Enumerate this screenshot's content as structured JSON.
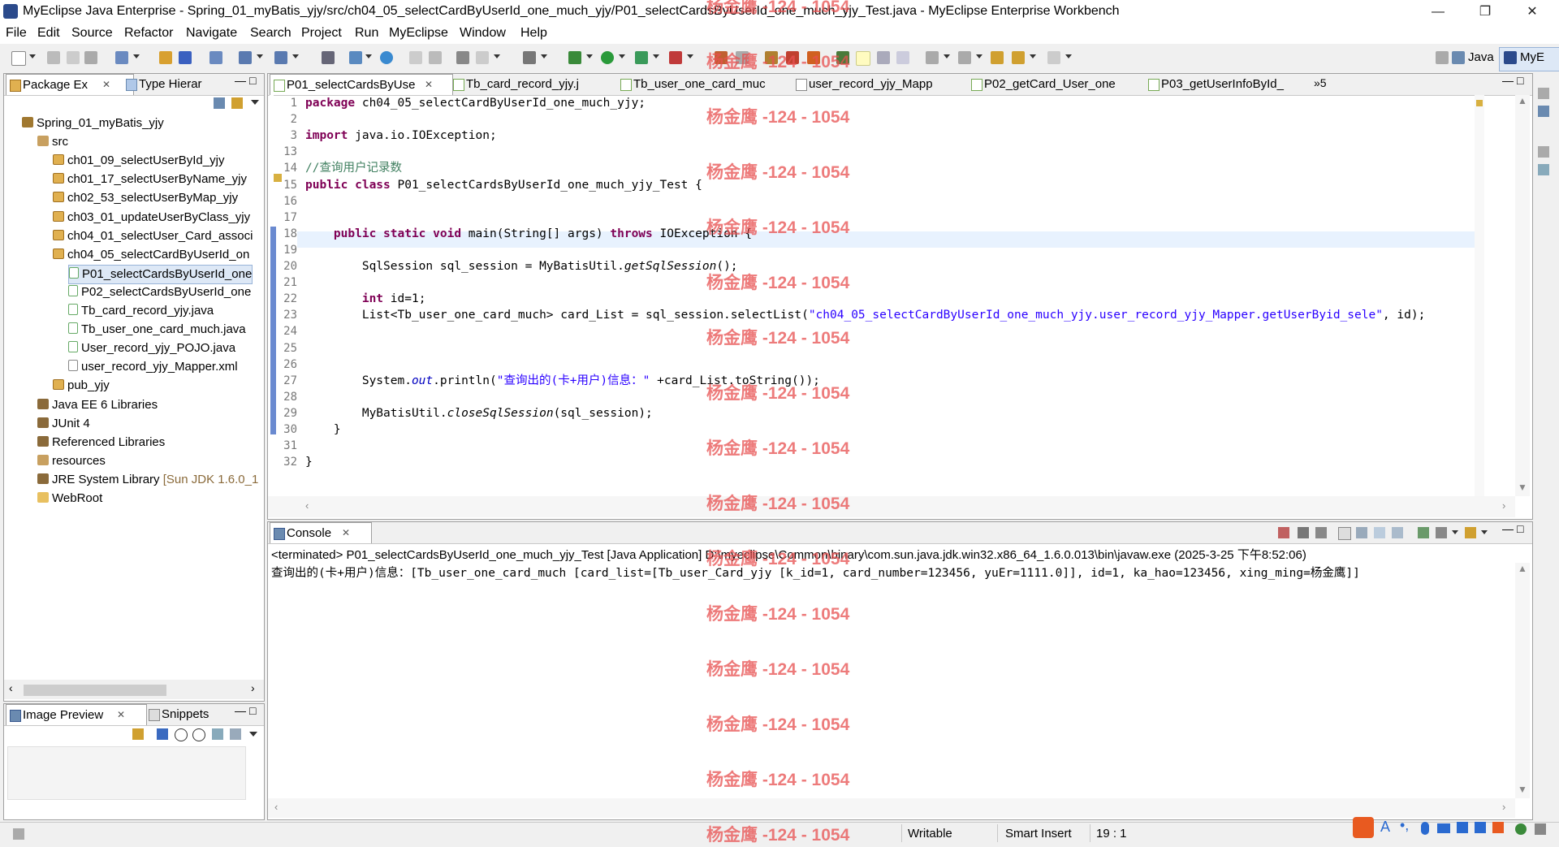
{
  "window": {
    "title": "MyEclipse Java Enterprise - Spring_01_myBatis_yjy/src/ch04_05_selectCardByUserId_one_much_yjy/P01_selectCardsByUserId_one_much_yjy_Test.java - MyEclipse Enterprise Workbench",
    "minimize": "—",
    "restore": "❐",
    "close": "✕"
  },
  "menu": [
    "File",
    "Edit",
    "Source",
    "Refactor",
    "Navigate",
    "Search",
    "Project",
    "Run",
    "MyEclipse",
    "Window",
    "Help"
  ],
  "perspectives": {
    "java": "Java",
    "myeclipse": "MyE"
  },
  "package_explorer": {
    "tabs": [
      "Package Ex",
      "Type Hierar"
    ],
    "tree": [
      {
        "label": "Spring_01_myBatis_yjy",
        "icon": "project-icon",
        "depth": 0
      },
      {
        "label": "src",
        "icon": "source-folder-icon",
        "depth": 1
      },
      {
        "label": "ch01_09_selectUserById_yjy",
        "icon": "package-icon",
        "depth": 2
      },
      {
        "label": "ch01_17_selectUserByName_yjy",
        "icon": "package-icon",
        "depth": 2
      },
      {
        "label": "ch02_53_selectUserByMap_yjy",
        "icon": "package-icon",
        "depth": 2
      },
      {
        "label": "ch03_01_updateUserByClass_yjy",
        "icon": "package-icon",
        "depth": 2
      },
      {
        "label": "ch04_01_selectUser_Card_associ",
        "icon": "package-icon",
        "depth": 2
      },
      {
        "label": "ch04_05_selectCardByUserId_on",
        "icon": "package-icon",
        "depth": 2
      },
      {
        "label": "P01_selectCardsByUserId_one",
        "icon": "java-file-icon",
        "depth": 3,
        "selected": true
      },
      {
        "label": "P02_selectCardsByUserId_one",
        "icon": "java-file-icon",
        "depth": 3
      },
      {
        "label": "Tb_card_record_yjy.java",
        "icon": "java-file-icon",
        "depth": 3
      },
      {
        "label": "Tb_user_one_card_much.java",
        "icon": "java-file-icon",
        "depth": 3
      },
      {
        "label": "User_record_yjy_POJO.java",
        "icon": "java-file-icon",
        "depth": 3
      },
      {
        "label": "user_record_yjy_Mapper.xml",
        "icon": "xml-file-icon",
        "depth": 3
      },
      {
        "label": "pub_yjy",
        "icon": "package-icon",
        "depth": 2
      },
      {
        "label": "Java EE 6 Libraries",
        "icon": "library-icon",
        "depth": 1
      },
      {
        "label": "JUnit 4",
        "icon": "library-icon",
        "depth": 1
      },
      {
        "label": "Referenced Libraries",
        "icon": "library-icon",
        "depth": 1
      },
      {
        "label": "resources",
        "icon": "source-folder-icon",
        "depth": 1
      },
      {
        "label": "JRE System Library",
        "suffix": "[Sun JDK 1.6.0_1",
        "icon": "library-icon",
        "depth": 1
      },
      {
        "label": "WebRoot",
        "icon": "folder-icon",
        "depth": 1
      }
    ]
  },
  "bottom_left": {
    "tabs": [
      "Image Preview",
      "Snippets"
    ]
  },
  "editor": {
    "tabs": [
      "P01_selectCardsByUse",
      "Tb_card_record_yjy.j",
      "Tb_user_one_card_muc",
      "user_record_yjy_Mapp",
      "P02_getCard_User_one",
      "P03_getUserInfoById_"
    ],
    "overflow": "»5",
    "lines": [
      {
        "n": "1",
        "segs": [
          {
            "c": "kw",
            "t": "package"
          },
          {
            "c": "",
            "t": " ch04_05_selectCardByUserId_one_much_yjy;"
          }
        ]
      },
      {
        "n": "2",
        "segs": []
      },
      {
        "n": "3",
        "segs": [
          {
            "c": "kw",
            "t": "import"
          },
          {
            "c": "",
            "t": " java.io.IOException;"
          }
        ]
      },
      {
        "n": "13",
        "segs": []
      },
      {
        "n": "14",
        "segs": [
          {
            "c": "cm",
            "t": "//查询用户记录数"
          }
        ]
      },
      {
        "n": "15",
        "segs": [
          {
            "c": "kw",
            "t": "public class"
          },
          {
            "c": "",
            "t": " P01_selectCardsByUserId_one_much_yjy_Test {"
          }
        ]
      },
      {
        "n": "16",
        "segs": []
      },
      {
        "n": "17",
        "segs": []
      },
      {
        "n": "18",
        "segs": [
          {
            "c": "",
            "t": "    "
          },
          {
            "c": "kw",
            "t": "public static void"
          },
          {
            "c": "",
            "t": " main(String[] args) "
          },
          {
            "c": "kw",
            "t": "throws"
          },
          {
            "c": "",
            "t": " IOException {"
          }
        ]
      },
      {
        "n": "19",
        "segs": []
      },
      {
        "n": "20",
        "segs": [
          {
            "c": "",
            "t": "        SqlSession sql_session = MyBatisUtil."
          },
          {
            "c": "it",
            "t": "getSqlSession"
          },
          {
            "c": "",
            "t": "();"
          }
        ]
      },
      {
        "n": "21",
        "segs": []
      },
      {
        "n": "22",
        "segs": [
          {
            "c": "",
            "t": "        "
          },
          {
            "c": "kw",
            "t": "int"
          },
          {
            "c": "",
            "t": " id=1;"
          }
        ]
      },
      {
        "n": "23",
        "segs": [
          {
            "c": "",
            "t": "        List<Tb_user_one_card_much> card_List = sql_session.selectList("
          },
          {
            "c": "st",
            "t": "\"ch04_05_selectCardByUserId_one_much_yjy.user_record_yjy_Mapper.getUserByid_sele\""
          },
          {
            "c": "",
            "t": ", id);"
          }
        ]
      },
      {
        "n": "24",
        "segs": []
      },
      {
        "n": "25",
        "segs": []
      },
      {
        "n": "26",
        "segs": []
      },
      {
        "n": "27",
        "segs": [
          {
            "c": "",
            "t": "        System."
          },
          {
            "c": "fld",
            "t": "out"
          },
          {
            "c": "",
            "t": ".println("
          },
          {
            "c": "st",
            "t": "\"查询出的(卡+用户)信息：\""
          },
          {
            "c": "",
            "t": " +card_List.toString());"
          }
        ]
      },
      {
        "n": "28",
        "segs": []
      },
      {
        "n": "29",
        "segs": [
          {
            "c": "",
            "t": "        MyBatisUtil."
          },
          {
            "c": "it",
            "t": "closeSqlSession"
          },
          {
            "c": "",
            "t": "(sql_session);"
          }
        ]
      },
      {
        "n": "30",
        "segs": [
          {
            "c": "",
            "t": "    }"
          }
        ]
      },
      {
        "n": "31",
        "segs": []
      },
      {
        "n": "32",
        "segs": [
          {
            "c": "",
            "t": "}"
          }
        ]
      }
    ]
  },
  "console": {
    "tab": "Console",
    "header": "<terminated> P01_selectCardsByUserId_one_much_yjy_Test [Java Application] D:\\myeclipse\\Common\\binary\\com.sun.java.jdk.win32.x86_64_1.6.0.013\\bin\\javaw.exe (2025-3-25 下午8:52:06)",
    "output": "查询出的(卡+用户)信息：[Tb_user_one_card_much [card_list=[Tb_user_Card_yjy [k_id=1, card_number=123456, yuEr=1111.0]], id=1, ka_hao=123456, xing_ming=杨金鹰]]"
  },
  "watermark": "杨金鹰 -124 - 1054",
  "status": {
    "mode": "Writable",
    "insert": "Smart Insert",
    "position": "19 : 1"
  },
  "colors": {
    "keyword": "#7f0055",
    "comment": "#3f7f5f",
    "string": "#2a00ff",
    "watermark": "#e85050"
  }
}
